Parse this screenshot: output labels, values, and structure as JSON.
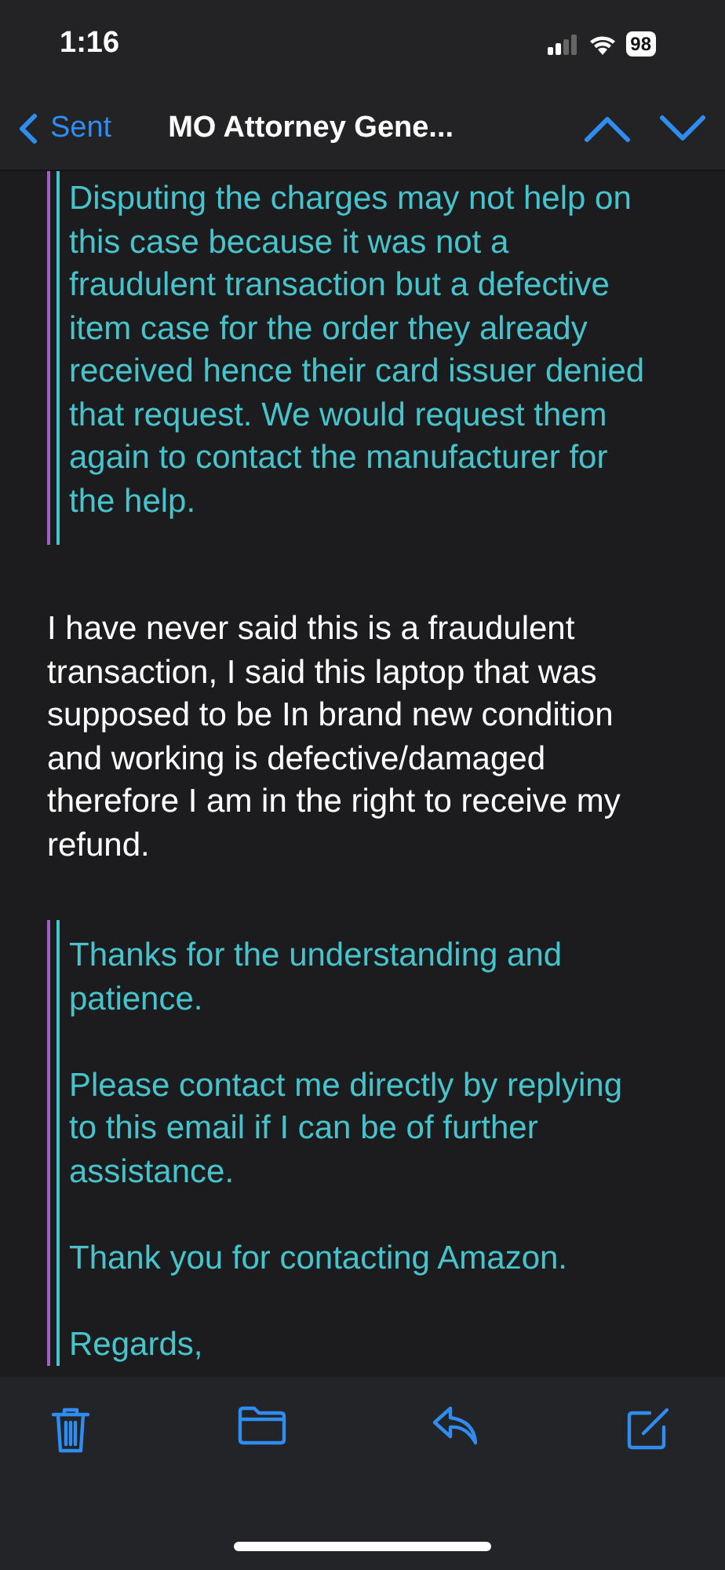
{
  "status_bar": {
    "time": "1:16",
    "battery": "98"
  },
  "nav": {
    "back": "Sent",
    "title": "MO Attorney Gene..."
  },
  "blocks": [
    {
      "kind": "quote",
      "paragraphs": [
        [
          "Disputing the charges may not help on",
          "this case because it was not a",
          "fraudulent transaction but a defective",
          "item case for the order they already",
          "received hence their card issuer denied",
          "that request. We would request them",
          "again to contact the manufacturer for",
          "the help."
        ]
      ]
    },
    {
      "kind": "text",
      "paragraphs": [
        [
          "I have never said this is a fraudulent",
          "transaction, I said this laptop that was",
          "supposed to be In brand new condition",
          "and working is defective/damaged",
          "therefore I am in the right to receive my",
          "refund."
        ]
      ]
    },
    {
      "kind": "quote",
      "paragraphs": [
        [
          "Thanks for the understanding and",
          "patience."
        ],
        [
          "Please contact me directly by replying",
          "to this email if I can be of further",
          "assistance."
        ],
        [
          "Thank you for contacting Amazon."
        ],
        [
          "Regards,"
        ]
      ]
    }
  ]
}
